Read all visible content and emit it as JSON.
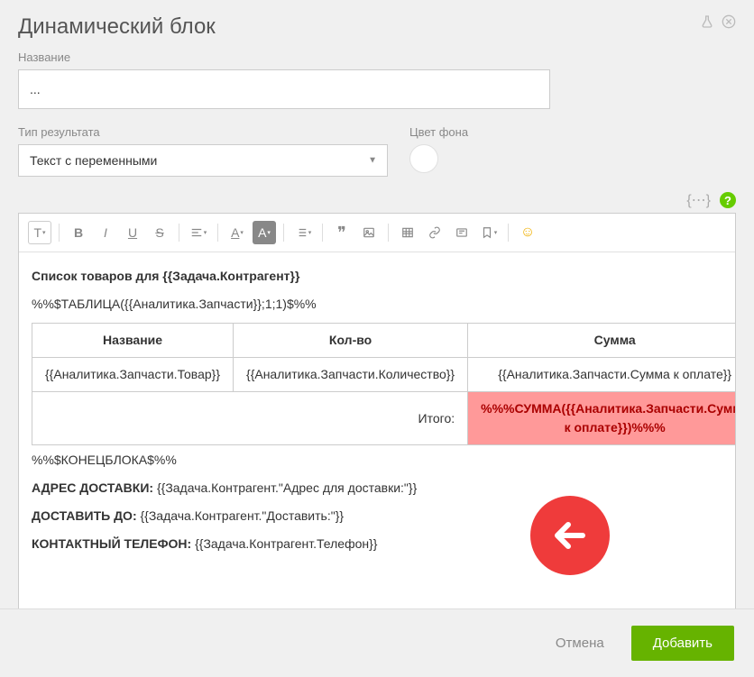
{
  "header": {
    "title": "Динамический блок"
  },
  "fields": {
    "name_label": "Название",
    "name_value": "...",
    "result_type_label": "Тип результата",
    "result_type_value": "Текст с переменными",
    "bg_color_label": "Цвет фона"
  },
  "editor": {
    "line1_bold": "Список товаров для {{Задача.Контрагент}}",
    "line2": "%%$ТАБЛИЦА({{Аналитика.Запчасти}};1;1)$%%",
    "table": {
      "headers": [
        "Название",
        "Кол-во",
        "Сумма"
      ],
      "row": [
        "{{Аналитика.Запчасти.Товар}}",
        "{{Аналитика.Запчасти.Количество}}",
        "{{Аналитика.Запчасти.Сумма к оплате}}"
      ],
      "total_label": "Итого:",
      "total_value": "%%%СУММА({{Аналитика.Запчасти.Сумма к оплате}})%%%"
    },
    "line3": "%%$КОНЕЦБЛОКА$%%",
    "addr_label": "АДРЕС ДОСТАВКИ:",
    "addr_value": " {{Задача.Контрагент.\"Адрес для доставки:\"}}",
    "deliver_label": "ДОСТАВИТЬ ДО:",
    "deliver_value": " {{Задача.Контрагент.\"Доставить:\"}}",
    "phone_label": "КОНТАКТНЫЙ ТЕЛЕФОН:",
    "phone_value": " {{Задача.Контрагент.Телефон}}"
  },
  "footer": {
    "cancel": "Отмена",
    "submit": "Добавить"
  },
  "icons": {
    "help": "?",
    "braces": "{⋯}"
  }
}
